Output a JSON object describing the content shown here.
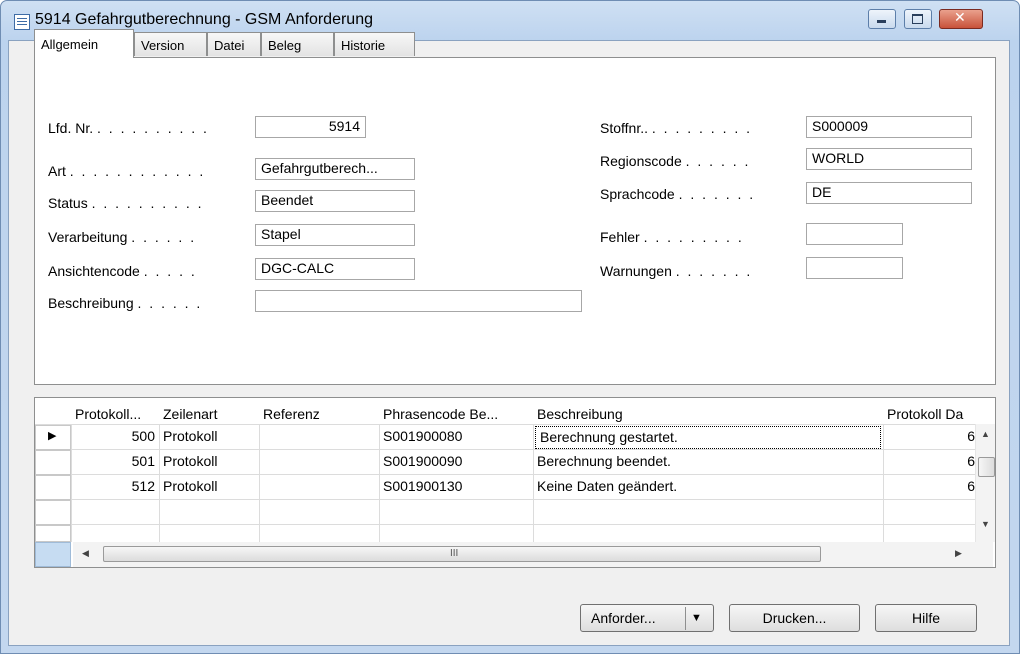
{
  "window": {
    "title": "5914 Gefahrgutberechnung - GSM Anforderung",
    "icon": "table-icon",
    "controls": [
      "minimize-icon",
      "maximize-icon",
      "close-icon"
    ]
  },
  "tabs": [
    {
      "label": "Allgemein",
      "active": true
    },
    {
      "label": "Version",
      "active": false
    },
    {
      "label": "Datei",
      "active": false
    },
    {
      "label": "Beleg",
      "active": false
    },
    {
      "label": "Historie",
      "active": false
    }
  ],
  "general": {
    "lfd_nr": {
      "label": "Lfd. Nr.",
      "dots": ". . . . . . . . . .",
      "value": "5914"
    },
    "art": {
      "label": "Art",
      "dots": ". . . . . . . . . . . .",
      "value": "Gefahrgutberech..."
    },
    "status": {
      "label": "Status",
      "dots": ". . . . . . . . . .",
      "value": "Beendet"
    },
    "verarbeitung": {
      "label": "Verarbeitung",
      "dots": ". . . . . .",
      "value": "Stapel"
    },
    "ansichtencode": {
      "label": "Ansichtencode",
      "dots": ". . . . .",
      "value": "DGC-CALC"
    },
    "beschreibung": {
      "label": "Beschreibung",
      "dots": ". . . . . .",
      "value": ""
    },
    "stoffnr": {
      "label": "Stoffnr..",
      "dots": ". . . . . . . . .",
      "value": "S000009"
    },
    "regionscode": {
      "label": "Regionscode",
      "dots": ". . . . . .",
      "value": "WORLD"
    },
    "sprachcode": {
      "label": "Sprachcode",
      "dots": ". . . . . . .",
      "value": "DE"
    },
    "fehler": {
      "label": "Fehler",
      "dots": ". . . . . . . . .",
      "value": ""
    },
    "warnungen": {
      "label": "Warnungen",
      "dots": ". . . . . . .",
      "value": ""
    }
  },
  "grid": {
    "columns": [
      "Protokoll...",
      "Zeilenart",
      "Referenz",
      "Phrasencode Be...",
      "Beschreibung",
      "Protokoll Da"
    ],
    "rows": [
      {
        "nr": "500",
        "zeilenart": "Protokoll",
        "referenz": "",
        "phrasencode": "S001900080",
        "beschreibung": "Berechnung gestartet.",
        "datum": "6",
        "selected": true
      },
      {
        "nr": "501",
        "zeilenart": "Protokoll",
        "referenz": "",
        "phrasencode": "S001900090",
        "beschreibung": "Berechnung beendet.",
        "datum": "6",
        "selected": false
      },
      {
        "nr": "512",
        "zeilenart": "Protokoll",
        "referenz": "",
        "phrasencode": "S001900130",
        "beschreibung": "Keine Daten geändert.",
        "datum": "6",
        "selected": false
      }
    ],
    "hscroll_label": "III"
  },
  "buttons": {
    "anforder": "Anforder...",
    "drucken": "Drucken...",
    "hilfe": "Hilfe"
  }
}
